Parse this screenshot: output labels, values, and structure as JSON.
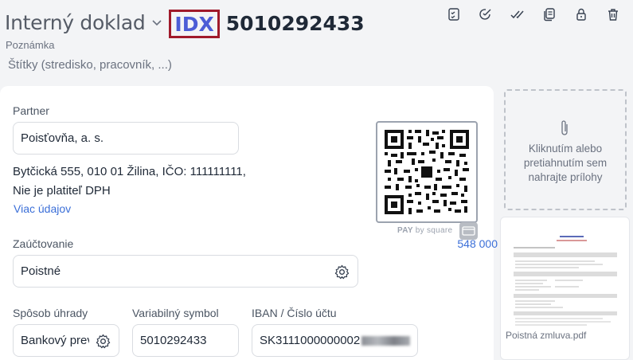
{
  "header": {
    "doc_type": "Interný doklad",
    "doc_prefix": "IDX",
    "doc_number": "5010292433"
  },
  "toolbar": {
    "icons": [
      "checklist-icon",
      "edit-check-icon",
      "double-check-icon",
      "copy-icon",
      "lock-icon",
      "trash-icon"
    ]
  },
  "note_placeholder": "Poznámka",
  "tags_placeholder": "Štítky (stredisko, pracovník, ...)",
  "partner": {
    "label": "Partner",
    "value": "Poisťovňa, a. s.",
    "address": "Bytčická 555, 010 01 Žilina, IČO: 111111111,",
    "vat_status": "Nie je platiteľ DPH",
    "more_link": "Viac údajov"
  },
  "posting": {
    "label": "Zaúčtovanie",
    "amount": "548 000",
    "value": "Poistné"
  },
  "payment": {
    "method_label": "Spôsob úhrady",
    "method_value": "Bankový prevod",
    "vs_label": "Variabilný symbol",
    "vs_value": "5010292433",
    "iban_label": "IBAN / Číslo účtu",
    "iban_value": "SK3111000000002"
  },
  "qr": {
    "caption_pay": "PAY",
    "caption_by": "by square"
  },
  "attachments": {
    "dropzone_text": "Kliknutím alebo pretiahnutím sem nahrajte prílohy",
    "files": [
      {
        "name": "Poistná zmluva.pdf"
      }
    ]
  },
  "colors": {
    "accent": "#4c5dd6",
    "link": "#3b6fd8",
    "highlight_border": "#a01a2b",
    "background": "#f3f4f6"
  }
}
